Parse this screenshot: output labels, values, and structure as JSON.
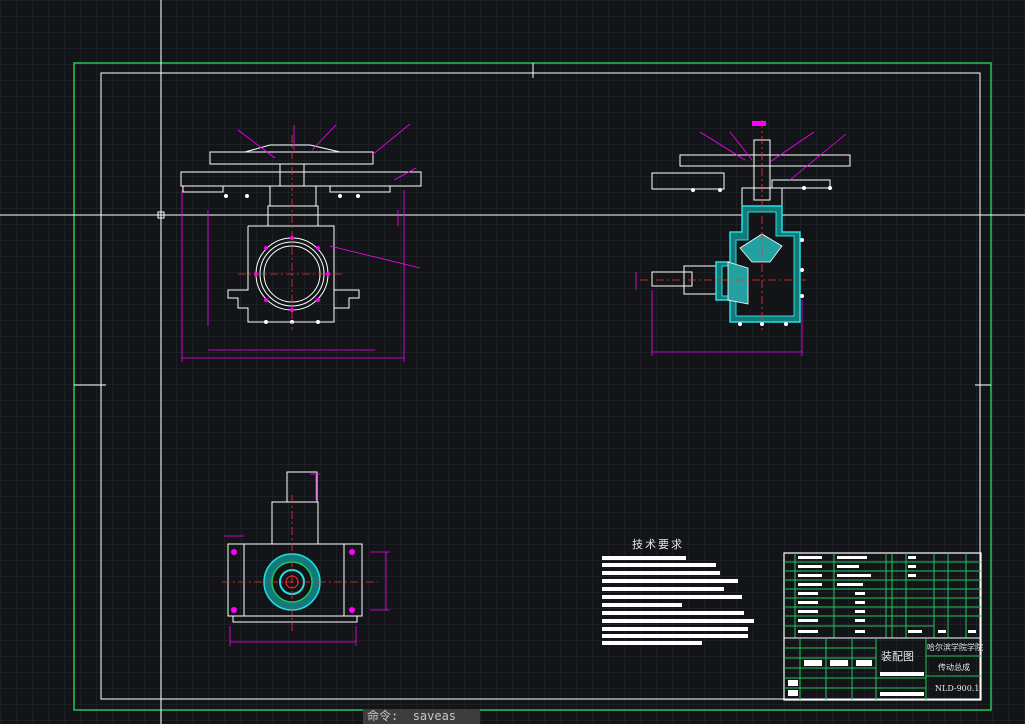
{
  "app": {
    "background": "#121417",
    "grid_color": "#2a2e33",
    "frame_color": "#22c55e",
    "line_color": "#ffffff",
    "accent_magenta": "#ff00ff",
    "accent_cyan": "#23e0e0",
    "accent_red": "#ff3030"
  },
  "drawing": {
    "tech_requirements_title": "技术要求",
    "title_block": {
      "drawing_name": "装配图",
      "institution": "哈尔滨学院学院",
      "part_name": "传动总成",
      "drawing_number": "NLD-900.1"
    }
  },
  "command_line": {
    "prompt": "命令:",
    "value": "saveas"
  }
}
